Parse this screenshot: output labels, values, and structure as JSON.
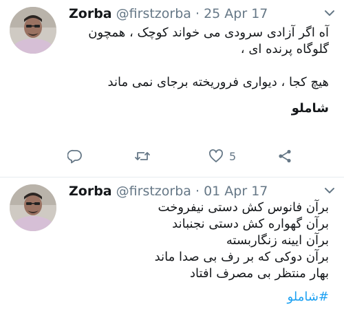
{
  "tweets": [
    {
      "display_name": "Zorba",
      "handle": "@firstzorba",
      "separator": "·",
      "date": "25 Apr 17",
      "lines": [
        "آه اگر آزادی سرودی می خواند کوچک ، همچون",
        "گلوگاه پرنده ای ،",
        "",
        "هیچ کجا ، دیواری فروریخته برجای نمی ماند"
      ],
      "hashtag": "شاملو",
      "like_count": "5"
    },
    {
      "display_name": "Zorba",
      "handle": "@firstzorba",
      "separator": "·",
      "date": "01 Apr 17",
      "lines": [
        "برآن فانوس کش دستی نیفروخت",
        "برآن گهواره کش دستی نجنباند",
        "برآن ایینه زنگاربسته",
        "برآن دوکی که بر رف بی صدا ماند",
        "بهار منتظر بی مصرف افتاد"
      ],
      "hashtag": "#شاملو"
    }
  ],
  "colors": {
    "text": "#14171a",
    "secondary": "#657786",
    "link": "#1da1f2",
    "divider": "#e6ecf0"
  },
  "icons": [
    "caret-down-icon",
    "reply-icon",
    "retweet-icon",
    "like-icon",
    "share-icon"
  ]
}
